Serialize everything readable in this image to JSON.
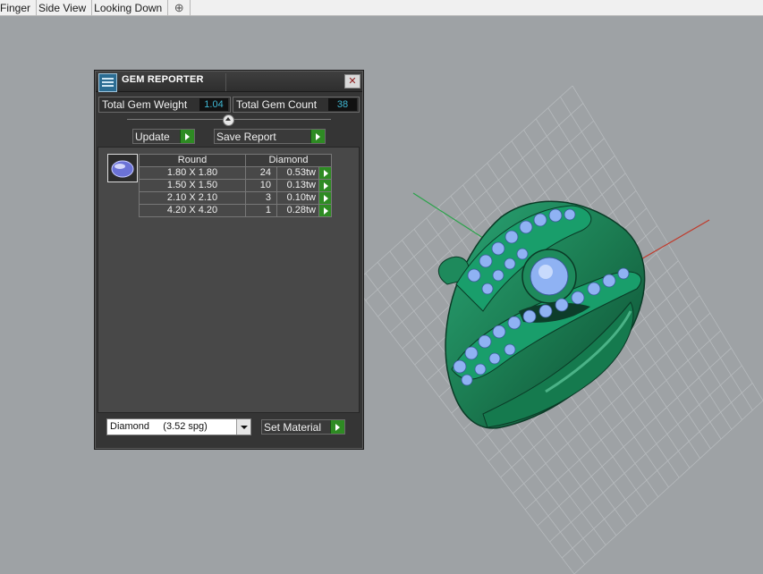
{
  "tabs": [
    {
      "label": "Finger"
    },
    {
      "label": "Side View"
    },
    {
      "label": "Looking Down"
    }
  ],
  "colors": {
    "viewport_bg": "#9ea2a5",
    "grid_line": "#b7bbbe",
    "ring_green": "#1e8a5c",
    "gem_blue": "#8fb2f3",
    "axis_x": "#c03a2b",
    "axis_y": "#2aa34a",
    "accent_value": "#3fb7d3"
  },
  "icons": {
    "app": "gem-reporter-icon",
    "close": "close-icon",
    "add_tab": "plus-icon",
    "go": "play-arrow-icon"
  },
  "panel": {
    "title": "GEM REPORTER",
    "close_glyph": "✕",
    "total_weight_label": "Total Gem Weight",
    "total_weight_value": "1.04",
    "total_count_label": "Total Gem Count",
    "total_count_value": "38",
    "update_label": "Update",
    "save_report_label": "Save Report",
    "table": {
      "shape_header": "Round",
      "material_header": "Diamond",
      "rows": [
        {
          "size": "1.80 X 1.80",
          "count": "24",
          "tw": "0.53tw"
        },
        {
          "size": "1.50 X 1.50",
          "count": "10",
          "tw": "0.13tw"
        },
        {
          "size": "2.10 X 2.10",
          "count": "3",
          "tw": "0.10tw"
        },
        {
          "size": "4.20 X 4.20",
          "count": "1",
          "tw": "0.28tw"
        }
      ]
    },
    "material_select": "Diamond     (3.52 spg)",
    "set_material_label": "Set Material"
  }
}
